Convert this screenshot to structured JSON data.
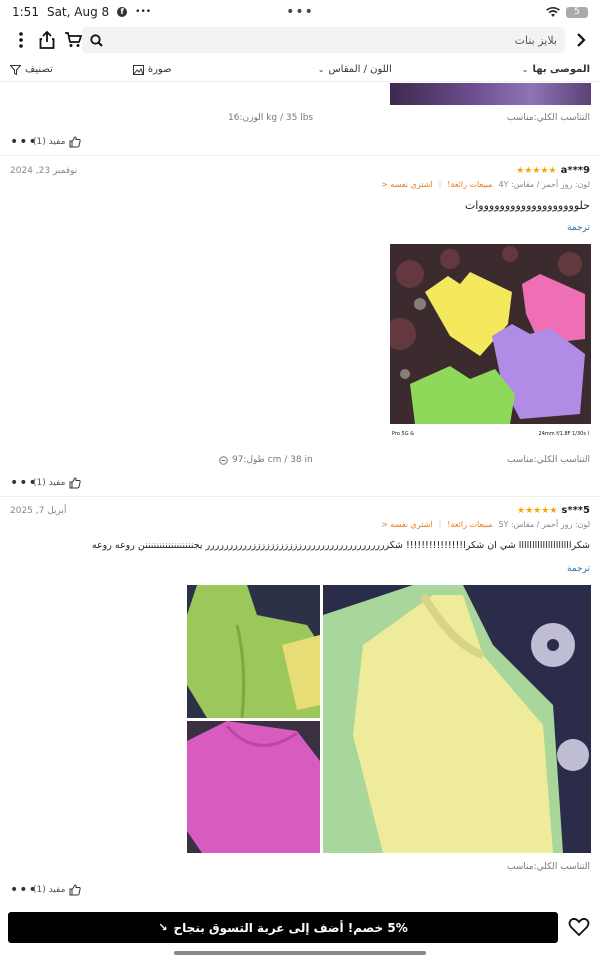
{
  "status_bar": {
    "time": "1:51",
    "date": "Sat, Aug 8",
    "app_icon": "facebook-icon",
    "dots": "•••",
    "battery": "5"
  },
  "search": {
    "placeholder": "بلايز بنات"
  },
  "filters": {
    "recommended": "الموصى بها",
    "color_size": "اللون / المقاس",
    "photo": "صورة",
    "sort": "تصنيف"
  },
  "review0": {
    "fit": "التناسب الكلي:مناسب",
    "weight": "الوزن:16 kg / 35 lbs",
    "helpful": "مفيد (1)"
  },
  "review1": {
    "user": "a***9",
    "date": "نوفمبر 23, 2024",
    "stars": "★★★★★",
    "sku": "لون: روز أحمر / مقاس: 4Y",
    "best_seller": "مبيعات رائعة!",
    "buy_same": "اشتري نفسه <",
    "text": "حلوووووووووووووووووووات",
    "translate": "ترجمة",
    "fit": "التناسب الكلي:مناسب",
    "height": "طول:97 cm / 38 in",
    "helpful": "مفيد (1)",
    "photo_caption_left": "Pro 5G &",
    "photo_caption_right": "24mm f/1.8F 1/30s I"
  },
  "review2": {
    "user": "s***5",
    "date": "أبريل 7, 2025",
    "stars": "★★★★★",
    "sku": "لون: روز أحمر / مقاس: 5Y",
    "best_seller": "مبيعات رائعة!",
    "buy_same": "اشتري نفسه <",
    "text": "شكراااااااااااااااااااا شي ان شكرا!!!!!!!!!!!!!!! شكرررررررررررررررررررزززززززززززرررررررررر يجنننننننننننننننننن روعه روعه",
    "translate": "ترجمة",
    "fit": "التناسب الكلي:مناسب",
    "helpful": "مفيد (1)"
  },
  "bottom": {
    "cart_label": "5% خصم! أضف إلى عربة التسوق بنجاح"
  },
  "colors": {
    "accent": "#000000",
    "star": "#f6a700",
    "link": "#2b6cb0",
    "orange": "#e67a1e"
  }
}
